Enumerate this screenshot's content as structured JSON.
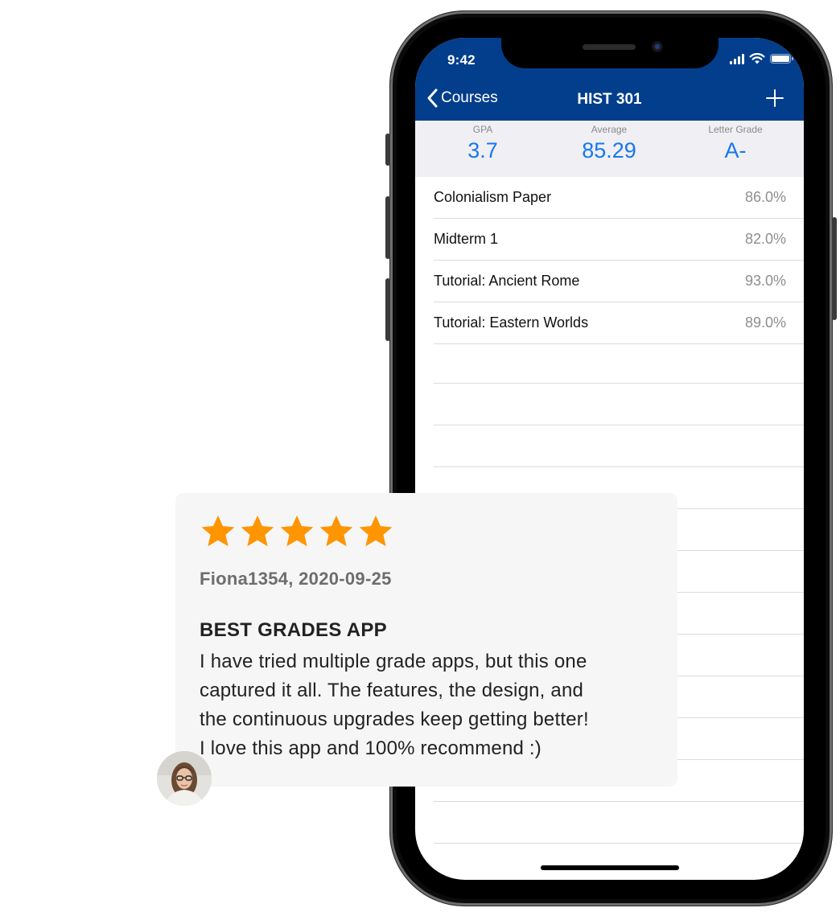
{
  "status_bar": {
    "time": "9:42"
  },
  "nav": {
    "back_label": "Courses",
    "title": "HIST 301",
    "color": "#033e8c"
  },
  "summary": {
    "gpa_label": "GPA",
    "gpa_value": "3.7",
    "average_label": "Average",
    "average_value": "85.29",
    "letter_label": "Letter Grade",
    "letter_value": "A-",
    "accent": "#1677f0"
  },
  "grades": [
    {
      "name": "Colonialism Paper",
      "percent": "86.0%"
    },
    {
      "name": "Midterm 1",
      "percent": "82.0%"
    },
    {
      "name": "Tutorial: Ancient Rome",
      "percent": "93.0%"
    },
    {
      "name": "Tutorial: Eastern Worlds",
      "percent": "89.0%"
    }
  ],
  "review": {
    "rating": 5,
    "star_color": "#ff9500",
    "author_line": "Fiona1354, 2020-09-25",
    "title": "BEST GRADES APP",
    "body_lines": [
      "I have tried multiple grade apps, but this one",
      "captured it all. The features, the design, and",
      "the continuous upgrades keep getting better!",
      "I love this app and 100% recommend :)"
    ]
  },
  "icons": {
    "back": "chevron-left-icon",
    "add": "plus-icon",
    "signal": "cellular-signal-icon",
    "wifi": "wifi-icon",
    "battery": "battery-icon",
    "star": "star-icon"
  }
}
